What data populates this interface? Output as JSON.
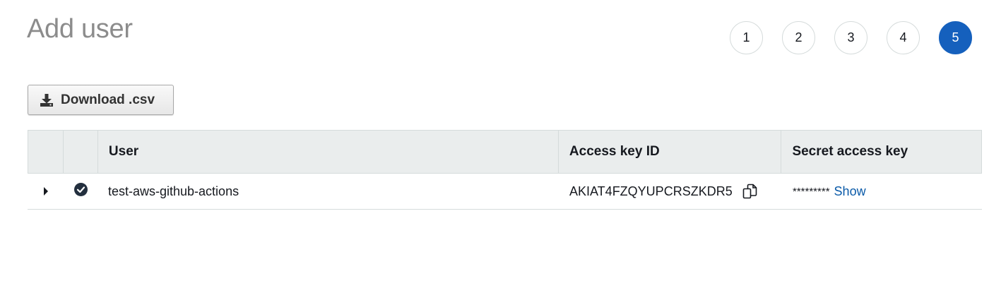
{
  "page": {
    "title": "Add user"
  },
  "steps": {
    "items": [
      "1",
      "2",
      "3",
      "4",
      "5"
    ],
    "active_index": 4,
    "active_color": "#1560bd"
  },
  "toolbar": {
    "download_label": "Download .csv",
    "download_icon": "download-icon"
  },
  "table": {
    "headers": {
      "user": "User",
      "access_key_id": "Access key ID",
      "secret_access_key": "Secret access key"
    },
    "rows": [
      {
        "expand_icon": "caret-right-icon",
        "status_icon": "check-circle-icon",
        "user": "test-aws-github-actions",
        "access_key_id": "AKIAT4FZQYUPCRSZKDR5",
        "copy_icon": "copy-icon",
        "secret_mask": "*********",
        "show_label": "Show"
      }
    ]
  },
  "colors": {
    "header_bg": "#eaeded",
    "link": "#0a5aa8",
    "title": "#8c8c8c"
  }
}
